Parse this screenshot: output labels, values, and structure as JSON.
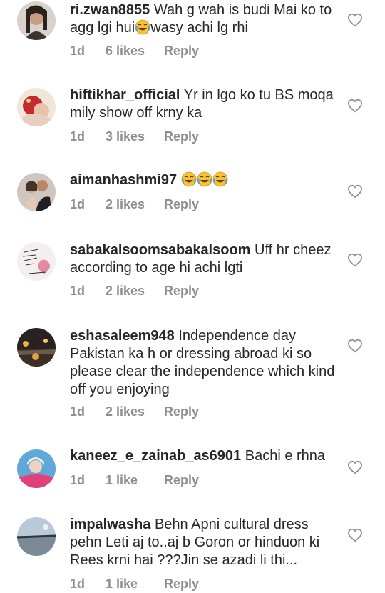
{
  "comments": [
    {
      "username": "ri.zwan8855",
      "text_a": "Wah g wah is budi Mai ko to agg lgi hui",
      "text_b": "wasy achi lg rhi",
      "time": "1d",
      "likes": "6 likes",
      "reply": "Reply"
    },
    {
      "username": "hiftikhar_official",
      "text": "Yr in lgo ko tu BS moqa mily show off krny ka",
      "time": "1d",
      "likes": "3 likes",
      "reply": "Reply"
    },
    {
      "username": "aimanhashmi97",
      "text": "",
      "time": "1d",
      "likes": "2 likes",
      "reply": "Reply"
    },
    {
      "username": "sabakalsoomsabakalsoom",
      "text": "Uff hr cheez according to age hi achi lgti",
      "time": "1d",
      "likes": "2 likes",
      "reply": "Reply"
    },
    {
      "username": "eshasaleem948",
      "text": "Independence day Pakistan ka h or dressing abroad ki so please clear the independence which kind off you enjoying",
      "time": "1d",
      "likes": "2 likes",
      "reply": "Reply"
    },
    {
      "username": "kaneez_e_zainab_as6901",
      "text": "Bachi e rhna",
      "time": "1d",
      "likes": "1 like",
      "reply": "Reply"
    },
    {
      "username": "impalwasha",
      "text": "Behn Apni cultural dress pehn Leti aj to..aj b Goron or hinduon ki Rees krni hai ???Jin se azadi li thi...",
      "time": "1d",
      "likes": "1 like",
      "reply": "Reply"
    }
  ],
  "icons": {
    "like": "heart-outline-icon",
    "laugh": "tears-of-joy-emoji"
  },
  "colors": {
    "text": "#262626",
    "meta": "#8e8e8e",
    "icon": "#8e8e8e",
    "emoji": "#f7c234"
  }
}
